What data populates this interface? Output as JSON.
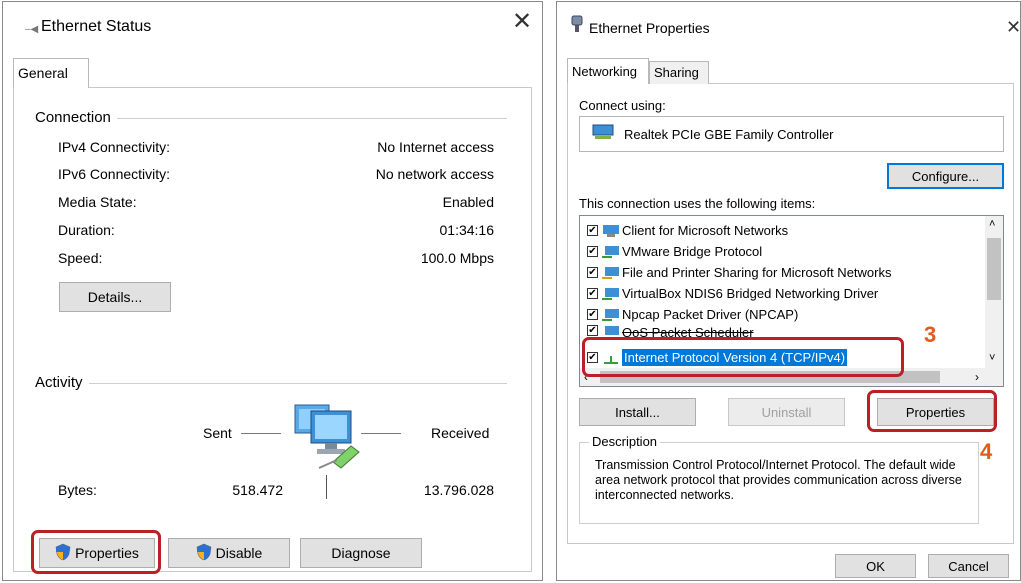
{
  "status_window": {
    "title": "Ethernet Status",
    "tab": "General",
    "connection_label": "Connection",
    "rows": [
      {
        "label": "IPv4 Connectivity:",
        "value": "No Internet access"
      },
      {
        "label": "IPv6 Connectivity:",
        "value": "No network access"
      },
      {
        "label": "Media State:",
        "value": "Enabled"
      },
      {
        "label": "Duration:",
        "value": "01:34:16"
      },
      {
        "label": "Speed:",
        "value": "100.0 Mbps"
      }
    ],
    "details_button": "Details...",
    "activity_label": "Activity",
    "sent_label": "Sent",
    "received_label": "Received",
    "bytes_label": "Bytes:",
    "bytes_sent": "518.472",
    "bytes_received": "13.796.028",
    "properties_button": "Properties",
    "disable_button": "Disable",
    "diagnose_button": "Diagnose"
  },
  "props_window": {
    "title": "Ethernet Properties",
    "tabs": [
      "Networking",
      "Sharing"
    ],
    "connect_using_label": "Connect using:",
    "adapter_name": "Realtek PCIe GBE Family Controller",
    "configure_button": "Configure...",
    "items_label": "This connection uses the following items:",
    "items": [
      "Client for Microsoft Networks",
      "VMware Bridge Protocol",
      "File and Printer Sharing for Microsoft Networks",
      "VirtualBox NDIS6 Bridged Networking Driver",
      "Npcap Packet Driver (NPCAP)",
      "QoS Packet Scheduler",
      "Internet Protocol Version 4 (TCP/IPv4)"
    ],
    "install_button": "Install...",
    "uninstall_button": "Uninstall",
    "properties_button": "Properties",
    "description_label": "Description",
    "description_text": "Transmission Control Protocol/Internet Protocol. The default wide area network protocol that provides communication across diverse interconnected networks.",
    "ok_button": "OK",
    "cancel_button": "Cancel"
  },
  "annotations": {
    "step3": "3",
    "step4": "4"
  },
  "colors": {
    "highlight": "#b92126",
    "annotation": "#e25a1c",
    "selection": "#0078d7"
  }
}
